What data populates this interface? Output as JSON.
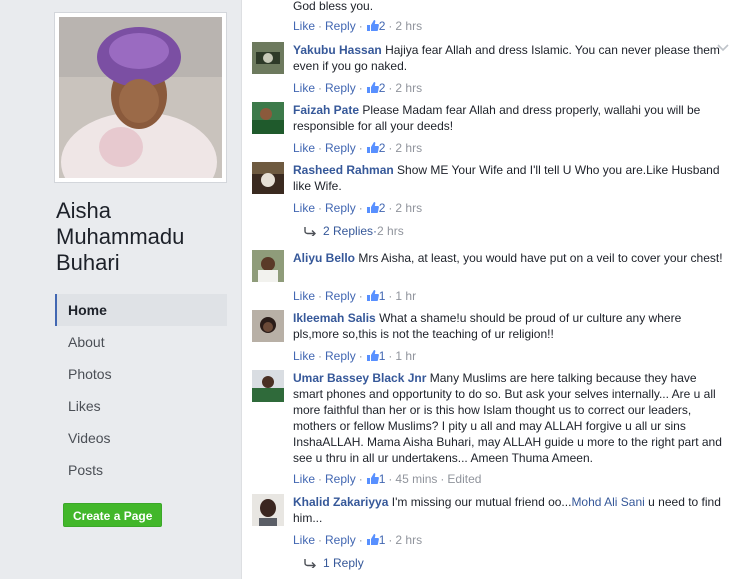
{
  "page": {
    "name_lines": [
      "Aisha",
      "Muhammadu",
      "Buhari"
    ],
    "nav": [
      "Home",
      "About",
      "Photos",
      "Likes",
      "Videos",
      "Posts"
    ],
    "create_page": "Create a Page"
  },
  "top_partial": {
    "text": "God bless you.",
    "like": "Like",
    "reply": "Reply",
    "likes": "2",
    "time": "2 hrs"
  },
  "comments": [
    {
      "author": "Yakubu Hassan",
      "text": "Hajiya fear Allah and dress Islamic. You can never please them even if you go naked.",
      "like": "Like",
      "reply": "Reply",
      "likes": "2",
      "time": "2 hrs"
    },
    {
      "author": "Faizah Pate",
      "text": "Please Madam fear Allah and dress properly, wallahi you will be responsible for all your deeds!",
      "like": "Like",
      "reply": "Reply",
      "likes": "2",
      "time": "2 hrs"
    },
    {
      "author": "Rasheed Rahman",
      "text": "Show ME Your Wife and I'll tell U Who you are.Like Husband like Wife.",
      "like": "Like",
      "reply": "Reply",
      "likes": "2",
      "time": "2 hrs",
      "replies_label": "2 Replies",
      "replies_time": "2 hrs"
    },
    {
      "author": "Aliyu Bello",
      "text": "Mrs Aisha, at least, you would have put on a veil to cover your chest!",
      "like": "Like",
      "reply": "Reply",
      "likes": "1",
      "time": "1 hr"
    },
    {
      "author": "Ikleemah Salis",
      "text": "What a shame!u should be proud of ur culture any where pls,more so,this is not the teaching of ur religion!!",
      "like": "Like",
      "reply": "Reply",
      "likes": "1",
      "time": "1 hr"
    },
    {
      "author": "Umar Bassey Black Jnr",
      "text": "Many Muslims are here talking because they have smart phones and opportunity to do so. But ask your selves internally... Are u all more faithful than her or is this how Islam thought us to correct our leaders, mothers or fellow Muslims? I pity u all and may ALLAH forgive u all ur sins InshaALLAH. Mama Aisha Buhari, may ALLAH guide u more to the right part and see u thru in all ur undertakens... Ameen Thuma Ameen.",
      "like": "Like",
      "reply": "Reply",
      "likes": "1",
      "time": "45 mins",
      "edited": "Edited"
    },
    {
      "author": "Khalid Zakariyya",
      "text": "I'm missing our mutual friend oo...",
      "mention": "Mohd Ali Sani",
      "text_after": " u need to find him...",
      "like": "Like",
      "reply": "Reply",
      "likes": "1",
      "time": "2 hrs",
      "replies_label": "1 Reply"
    }
  ],
  "colors": {
    "link": "#365899",
    "accent": "#4267b2",
    "green": "#42b72a"
  },
  "icons": [
    "thumbs-up-icon",
    "reply-arrow-icon",
    "chevron-down-icon"
  ]
}
